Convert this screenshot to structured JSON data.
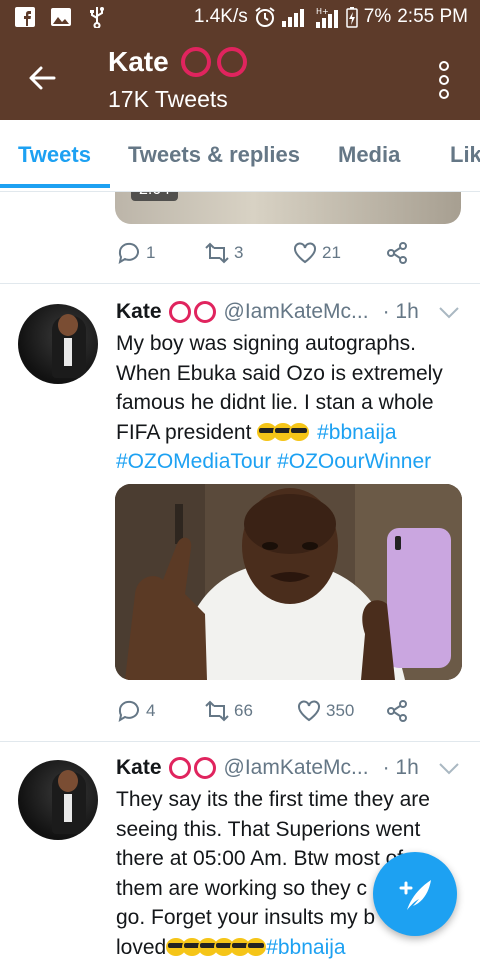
{
  "status_bar": {
    "net_speed": "1.4K/s",
    "battery": "7%",
    "time": "2:55 PM",
    "left_icons": [
      "facebook-icon",
      "gallery-icon",
      "usb-icon"
    ],
    "right_icons": [
      "alarm-icon",
      "signal-icon",
      "hplus-signal-icon",
      "battery-charging-icon"
    ]
  },
  "header": {
    "name": "Kate",
    "badge": "OO",
    "tweet_count": "17K Tweets",
    "back_icon": "arrow-left-icon",
    "menu_icon": "kebab-menu-icon"
  },
  "tabs": [
    {
      "label": "Tweets",
      "active": true
    },
    {
      "label": "Tweets & replies",
      "active": false
    },
    {
      "label": "Media",
      "active": false
    },
    {
      "label": "Lik",
      "active": false
    }
  ],
  "first_tweet": {
    "video_duration": "2:04",
    "replies": "1",
    "retweets": "3",
    "likes": "21"
  },
  "tweets": [
    {
      "name": "Kate",
      "badge": "OO",
      "handle": "@IamKateMc...",
      "time": "· 1h",
      "text_lines": [
        "My boy was signing autographs.",
        "When Ebuka said Ozo is extremely",
        "famous he didnt lie. I stan a whole",
        "FIFA president"
      ],
      "emoji_count_line4": 3,
      "hashtag_inline": "#bbnaija",
      "hashtags_line5": [
        "#OZOMediaTour",
        "#OZOourWinner"
      ],
      "replies": "4",
      "retweets": "66",
      "likes": "350"
    },
    {
      "name": "Kate",
      "badge": "OO",
      "handle": "@IamKateMc...",
      "time": "· 1h",
      "text_lines": [
        "They say its the first time they are",
        "seeing this. That Superions went",
        "there at 05:00 Am. Btw most of",
        "them are working so they c",
        "go. Forget your insults my b",
        "loved"
      ],
      "emoji_count_last": 6,
      "hashtag_last": "#bbnaija"
    }
  ],
  "fab": {
    "icon": "compose-tweet-icon"
  },
  "colors": {
    "brand_bar": "#5d3b2a",
    "accent": "#1da1f2",
    "badge": "#e0245e",
    "muted": "#657786"
  }
}
